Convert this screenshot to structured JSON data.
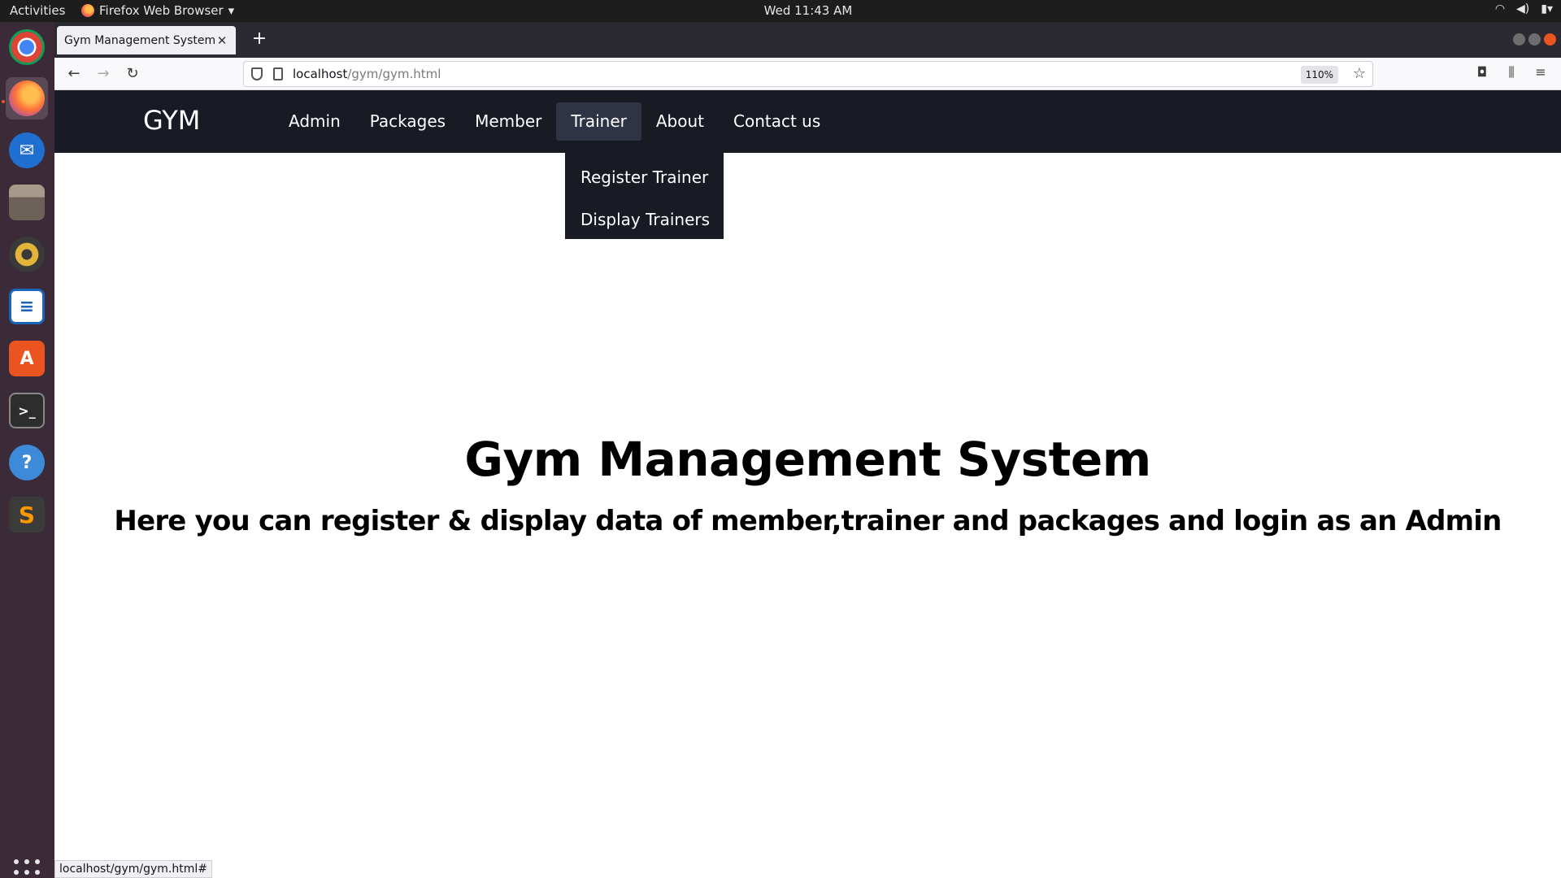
{
  "system": {
    "activities": "Activities",
    "app_name": "Firefox Web Browser",
    "clock": "Wed 11:43 AM"
  },
  "dock": {
    "items": [
      {
        "name": "chrome-icon",
        "glyph": "●",
        "color": "#4285f4"
      },
      {
        "name": "firefox-icon",
        "glyph": "●",
        "color": "#ff7139",
        "active": true
      },
      {
        "name": "thunderbird-icon",
        "glyph": "✉",
        "color": "#1f6fd1"
      },
      {
        "name": "files-icon",
        "glyph": "▭",
        "color": "#8a7a6a"
      },
      {
        "name": "rhythmbox-icon",
        "glyph": "◉",
        "color": "#d4a21c"
      },
      {
        "name": "writer-icon",
        "glyph": "≡",
        "color": "#1b65b8"
      },
      {
        "name": "software-icon",
        "glyph": "A",
        "color": "#e95420"
      },
      {
        "name": "terminal-icon",
        "glyph": ">_",
        "color": "#2d2d2d"
      },
      {
        "name": "help-icon",
        "glyph": "?",
        "color": "#3c8ad8"
      },
      {
        "name": "sublime-icon",
        "glyph": "S",
        "color": "#ff9800"
      }
    ]
  },
  "browser": {
    "tab_title": "Gym Management System",
    "url_host": "localhost",
    "url_path": "/gym/gym.html",
    "zoom": "110%",
    "status_url": "localhost/gym/gym.html#"
  },
  "site": {
    "brand": "GYM",
    "menu": [
      "Admin",
      "Packages",
      "Member",
      "Trainer",
      "About",
      "Contact us"
    ],
    "dropdown": [
      "Register Trainer",
      "Display Trainers"
    ],
    "title": "Gym Management System",
    "subtitle": "Here you can register & display data of member,trainer and packages and login as an Admin"
  }
}
